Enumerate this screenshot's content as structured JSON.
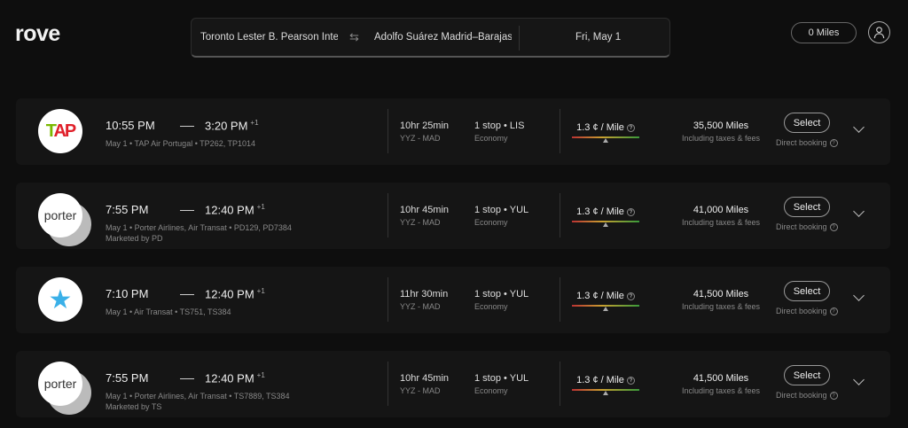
{
  "header": {
    "logo": "rove",
    "from": "Toronto Lester B. Pearson International Airport",
    "swap_icon": "swap-arrows-icon",
    "to": "Adolfo Suárez Madrid–Barajas Airport",
    "date": "Fri, May 1",
    "miles": "0 Miles",
    "avatar_icon": "user-icon"
  },
  "flights": [
    {
      "logo": "TAP",
      "depart": "10:55 PM",
      "arrive": "3:20 PM",
      "day_offset": "+1",
      "info": "May 1 • TAP Air Portugal • TP262, TP1014",
      "marketed": "",
      "duration": "10hr 25min",
      "route": "YYZ - MAD",
      "stops": "1 stop • LIS",
      "cabin": "Economy",
      "cpm": "1.3 ¢ / Mile",
      "miles": "35,500 Miles",
      "fees": "Including taxes & fees",
      "select": "Select",
      "booking": "Direct booking"
    },
    {
      "logo": "porter",
      "depart": "7:55 PM",
      "arrive": "12:40 PM",
      "day_offset": "+1",
      "info": "May 1 • Porter Airlines, Air Transat • PD129, PD7384",
      "marketed": "Marketed by PD",
      "duration": "10hr 45min",
      "route": "YYZ - MAD",
      "stops": "1 stop • YUL",
      "cabin": "Economy",
      "cpm": "1.3 ¢ / Mile",
      "miles": "41,000 Miles",
      "fees": "Including taxes & fees",
      "select": "Select",
      "booking": "Direct booking"
    },
    {
      "logo": "",
      "depart": "7:10 PM",
      "arrive": "12:40 PM",
      "day_offset": "+1",
      "info": "May 1 • Air Transat • TS751, TS384",
      "marketed": "",
      "duration": "11hr 30min",
      "route": "YYZ - MAD",
      "stops": "1 stop • YUL",
      "cabin": "Economy",
      "cpm": "1.3 ¢ / Mile",
      "miles": "41,500 Miles",
      "fees": "Including taxes & fees",
      "select": "Select",
      "booking": "Direct booking"
    },
    {
      "logo": "porter",
      "depart": "7:55 PM",
      "arrive": "12:40 PM",
      "day_offset": "+1",
      "info": "May 1 • Porter Airlines, Air Transat • TS7889, TS384",
      "marketed": "Marketed by TS",
      "duration": "10hr 45min",
      "route": "YYZ - MAD",
      "stops": "1 stop • YUL",
      "cabin": "Economy",
      "cpm": "1.3 ¢ / Mile",
      "miles": "41,500 Miles",
      "fees": "Including taxes & fees",
      "select": "Select",
      "booking": "Direct booking"
    }
  ]
}
